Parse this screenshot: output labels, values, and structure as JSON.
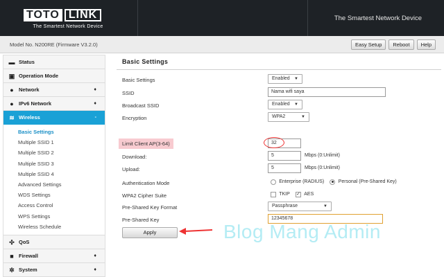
{
  "header": {
    "logo_left": "TOTO",
    "logo_right": "LINK",
    "logo_tagline": "The Smartest Network Device",
    "slogan": "The Smartest Network Device"
  },
  "model_bar": {
    "model": "Model No. N200RE (Firmware V3.2.0)",
    "buttons": [
      "Easy Setup",
      "Reboot",
      "Help"
    ]
  },
  "sidebar": {
    "items": [
      {
        "label": "Status",
        "icon": "monitor-icon"
      },
      {
        "label": "Operation Mode",
        "icon": "window-icon"
      },
      {
        "label": "Network",
        "icon": "globe-icon",
        "arrow": "♦"
      },
      {
        "label": "IPv6 Network",
        "icon": "globe-icon",
        "arrow": "♦"
      },
      {
        "label": "Wireless",
        "icon": "wifi-icon",
        "arrow": "-",
        "active": true
      }
    ],
    "wireless_sub": [
      "Basic Settings",
      "Multiple SSID 1",
      "Multiple SSID 2",
      "Multiple SSID 3",
      "Multiple SSID 4",
      "Advanced Settings",
      "WDS Settings",
      "Access Control",
      "WPS Settings",
      "Wireless Schedule"
    ],
    "items_after": [
      {
        "label": "QoS",
        "icon": "qos-icon"
      },
      {
        "label": "Firewall",
        "icon": "lock-icon",
        "arrow": "♦"
      },
      {
        "label": "System",
        "icon": "gear-icon",
        "arrow": "♦"
      }
    ]
  },
  "main": {
    "title": "Basic Settings",
    "rows": {
      "basic_settings": {
        "label": "Basic Settings",
        "value": "Enabled"
      },
      "ssid": {
        "label": "SSID",
        "value": "Nama wifi saya"
      },
      "broadcast_ssid": {
        "label": "Broadcast SSID",
        "value": "Enabled"
      },
      "encryption": {
        "label": "Encryption",
        "value": "WPA2"
      },
      "limit_client": {
        "label": "Limit Client AP(3-64)",
        "value": "32"
      },
      "download": {
        "label": "Download:",
        "value": "5",
        "note": "Mbps (0:Unlimit)"
      },
      "upload": {
        "label": "Upload:",
        "value": "5",
        "note": "Mbps (0:Unlimit)"
      },
      "auth_mode": {
        "label": "Authentication Mode",
        "opt1": "Enterprise (RADIUS)",
        "opt2": "Personal (Pre-Shared Key)"
      },
      "cipher": {
        "label": "WPA2 Cipher Suite",
        "opt1": "TKIP",
        "opt2": "AES"
      },
      "psk_format": {
        "label": "Pre-Shared Key Format",
        "value": "Passphrase"
      },
      "psk": {
        "label": "Pre-Shared Key",
        "value": "12345678"
      }
    },
    "apply_label": "Apply"
  },
  "watermark": "Blog Mang Admin",
  "colors": {
    "accent": "#1aa1d6",
    "header_bg": "#1e2226",
    "highlight": "#f8cbd0",
    "annotation": "#e33333"
  }
}
